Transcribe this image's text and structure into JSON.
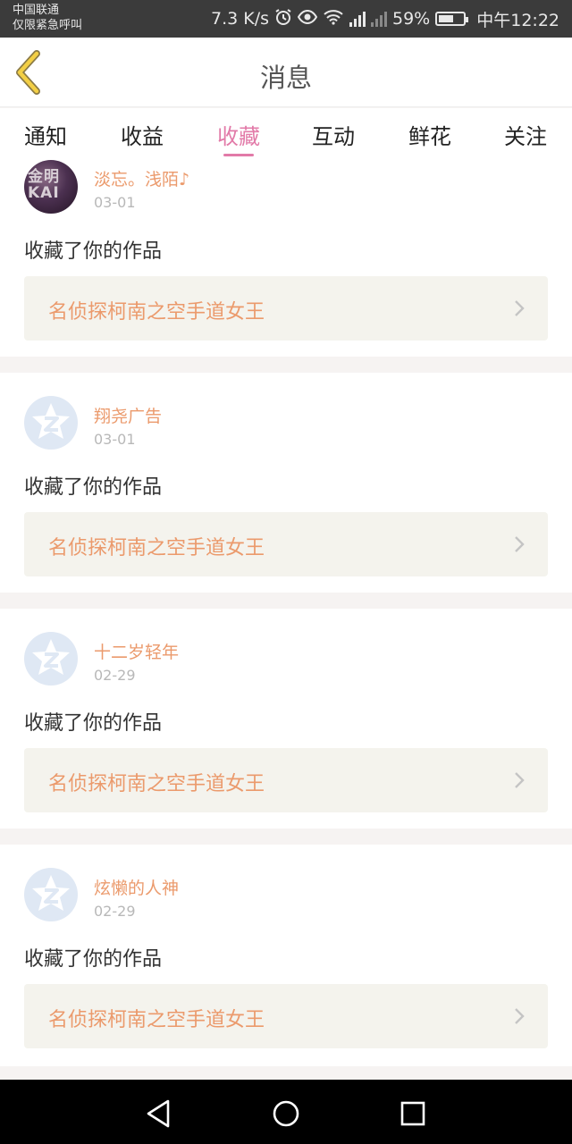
{
  "status_bar": {
    "carrier_line1": "中国联通",
    "carrier_line2": "仅限紧急呼叫",
    "net_speed": "7.3 K/s",
    "net_type": "4G",
    "battery": "59%",
    "battery_level": 0.59,
    "time": "中午12:22"
  },
  "header": {
    "title": "消息"
  },
  "tabs": [
    {
      "label": "通知"
    },
    {
      "label": "收益"
    },
    {
      "label": "收藏",
      "active": true
    },
    {
      "label": "互动"
    },
    {
      "label": "鲜花"
    },
    {
      "label": "关注"
    }
  ],
  "accent_color": "#e27aa8",
  "name_color": "#eb9a6c",
  "messages": [
    {
      "username": "淡忘。浅陌♪",
      "date": "03-01",
      "avatar_text": "金明 KAI",
      "text": "收藏了你的作品",
      "work_title": "名侦探柯南之空手道女王"
    },
    {
      "username": "翔尧广告",
      "date": "03-01",
      "text": "收藏了你的作品",
      "work_title": "名侦探柯南之空手道女王"
    },
    {
      "username": "十二岁轻年",
      "date": "02-29",
      "text": "收藏了你的作品",
      "work_title": "名侦探柯南之空手道女王"
    },
    {
      "username": "炫懒的人神",
      "date": "02-29",
      "text": "收藏了你的作品",
      "work_title": "名侦探柯南之空手道女王"
    }
  ],
  "icons": {
    "back": "back-chevron-icon",
    "default_avatar": "default-avatar-icon",
    "chevron": "chevron-right-icon",
    "nav_back": "triangle-back-icon",
    "nav_home": "circle-home-icon",
    "nav_recent": "square-recent-icon"
  }
}
